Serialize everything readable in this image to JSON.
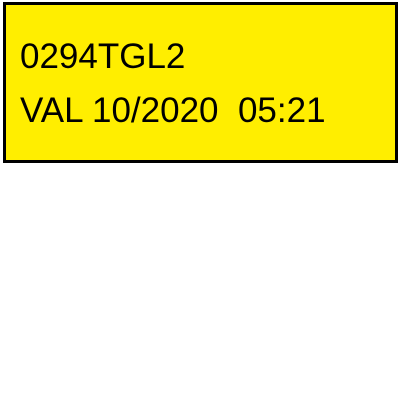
{
  "label": {
    "code": "0294TGL2",
    "validity_line": "VAL 10/2020  05:21",
    "background_color": "#ffee00",
    "border_color": "#000000",
    "text_color": "#000000"
  }
}
